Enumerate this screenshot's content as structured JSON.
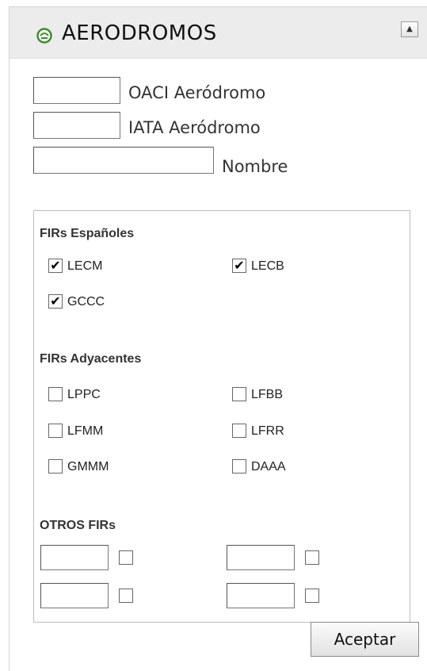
{
  "header": {
    "title": "AERODROMOS",
    "collapse_glyph": "▲"
  },
  "fields": {
    "oaci": {
      "label": "OACI Aeródromo",
      "value": ""
    },
    "iata": {
      "label": "IATA Aeródromo",
      "value": ""
    },
    "nombre": {
      "label": "Nombre",
      "value": ""
    }
  },
  "firs_espanoles": {
    "title": "FIRs Españoles",
    "items": [
      {
        "label": "LECM",
        "checked": true
      },
      {
        "label": "LECB",
        "checked": true
      },
      {
        "label": "GCCC",
        "checked": true
      }
    ]
  },
  "firs_adyacentes": {
    "title": "FIRs Adyacentes",
    "items": [
      {
        "label": "LPPC",
        "checked": false
      },
      {
        "label": "LFBB",
        "checked": false
      },
      {
        "label": "LFMM",
        "checked": false
      },
      {
        "label": "LFRR",
        "checked": false
      },
      {
        "label": "GMMM",
        "checked": false
      },
      {
        "label": "DAAA",
        "checked": false
      }
    ]
  },
  "otros_firs": {
    "title": "OTROS FIRs",
    "entries": [
      {
        "value": "",
        "checked": false
      },
      {
        "value": "",
        "checked": false
      },
      {
        "value": "",
        "checked": false
      },
      {
        "value": "",
        "checked": false
      }
    ]
  },
  "accept_label": "Aceptar",
  "colors": {
    "header_bg": "#ececec",
    "logo_green": "#3a8f2a"
  },
  "icons": {
    "logo": "green-globe-icon",
    "collapse": "triangle-up-icon"
  }
}
